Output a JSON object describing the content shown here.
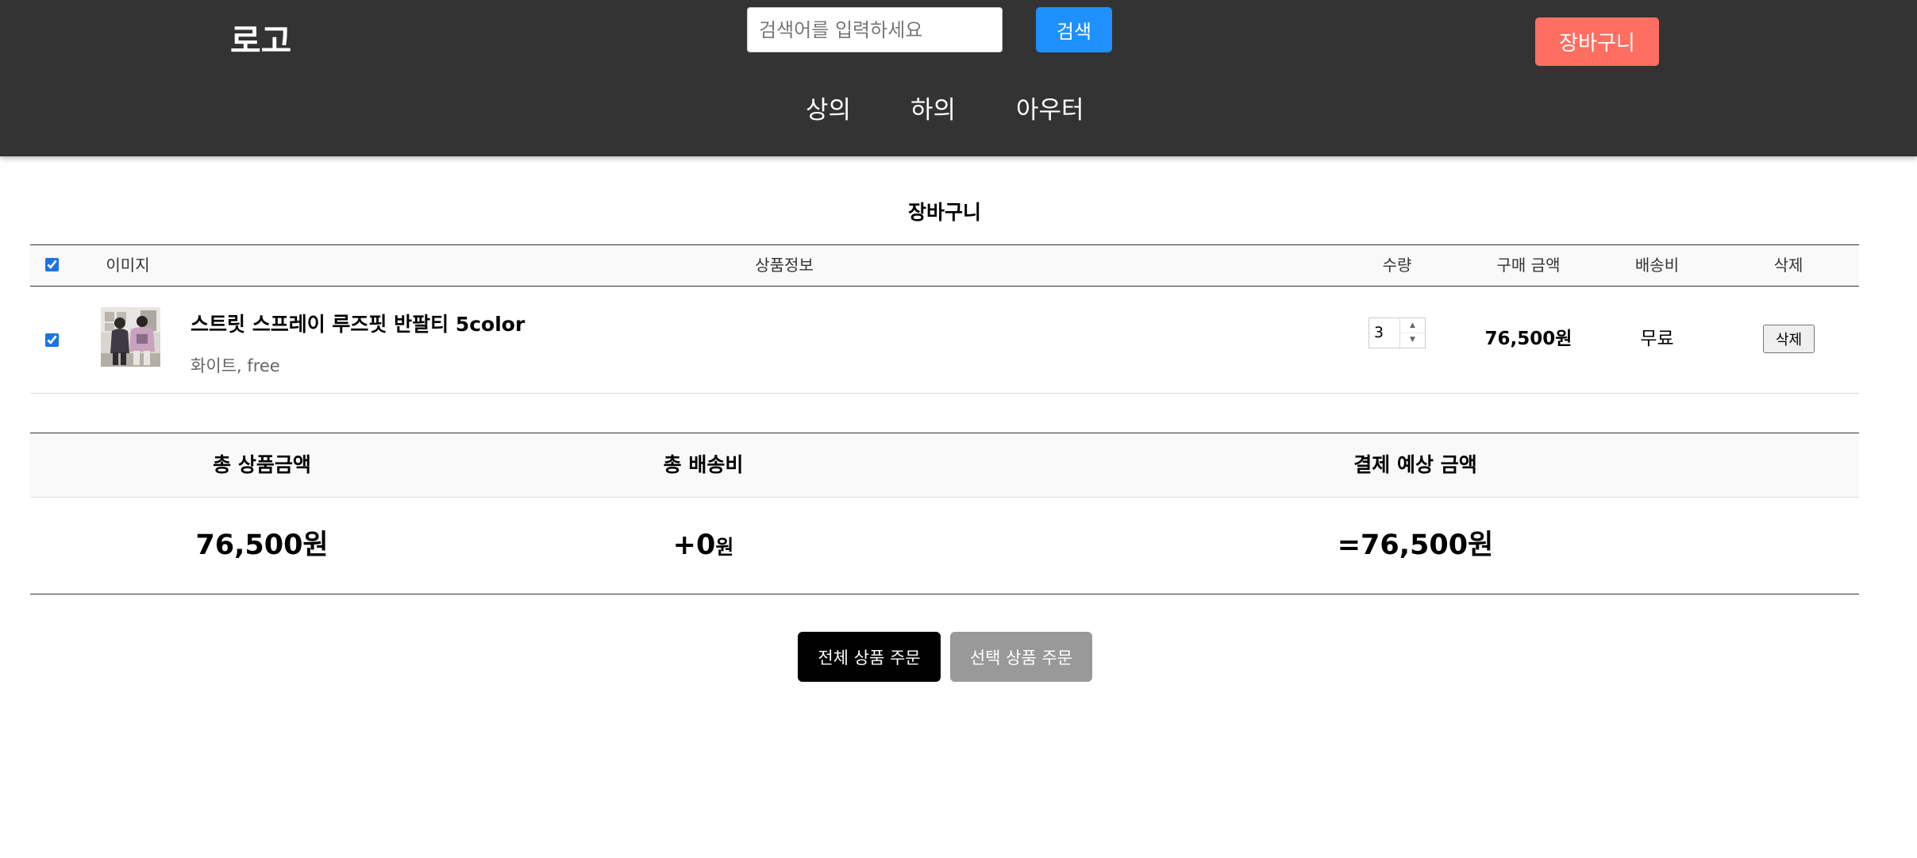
{
  "header": {
    "logo": "로고",
    "search": {
      "placeholder": "검색어를 입력하세요",
      "value": "",
      "button_label": "검색"
    },
    "cart_button_label": "장바구니",
    "nav": [
      "상의",
      "하의",
      "아우터"
    ],
    "colors": {
      "background": "#333333",
      "search_button": "#1e90ff",
      "cart_button": "#ff6f61"
    }
  },
  "page": {
    "title": "장바구니"
  },
  "cart_table": {
    "headers": {
      "select_all_checked": true,
      "image": "이미지",
      "product_info": "상품정보",
      "quantity": "수량",
      "price": "구매 금액",
      "shipping": "배송비",
      "delete": "삭제"
    },
    "items": [
      {
        "checked": true,
        "thumbnail": "product-photo",
        "name": "스트릿 스프레이 루즈핏 반팔티 5color",
        "option": "화이트, free",
        "quantity": "3",
        "price": "76,500원",
        "shipping": "무료",
        "delete_label": "삭제"
      }
    ]
  },
  "summary": {
    "labels": {
      "products_total": "총 상품금액",
      "shipping_total": "총 배송비",
      "payment_total": "결제 예상 금액"
    },
    "products_total": "76,500원",
    "shipping_total_sign": "+",
    "shipping_total_amount": "0",
    "shipping_total_unit": "원",
    "payment_total": "=76,500원"
  },
  "actions": {
    "order_all_label": "전체 상품 주문",
    "order_selected_label": "선택 상품 주문",
    "colors": {
      "order_all": "#000000",
      "order_selected": "#999999"
    }
  }
}
